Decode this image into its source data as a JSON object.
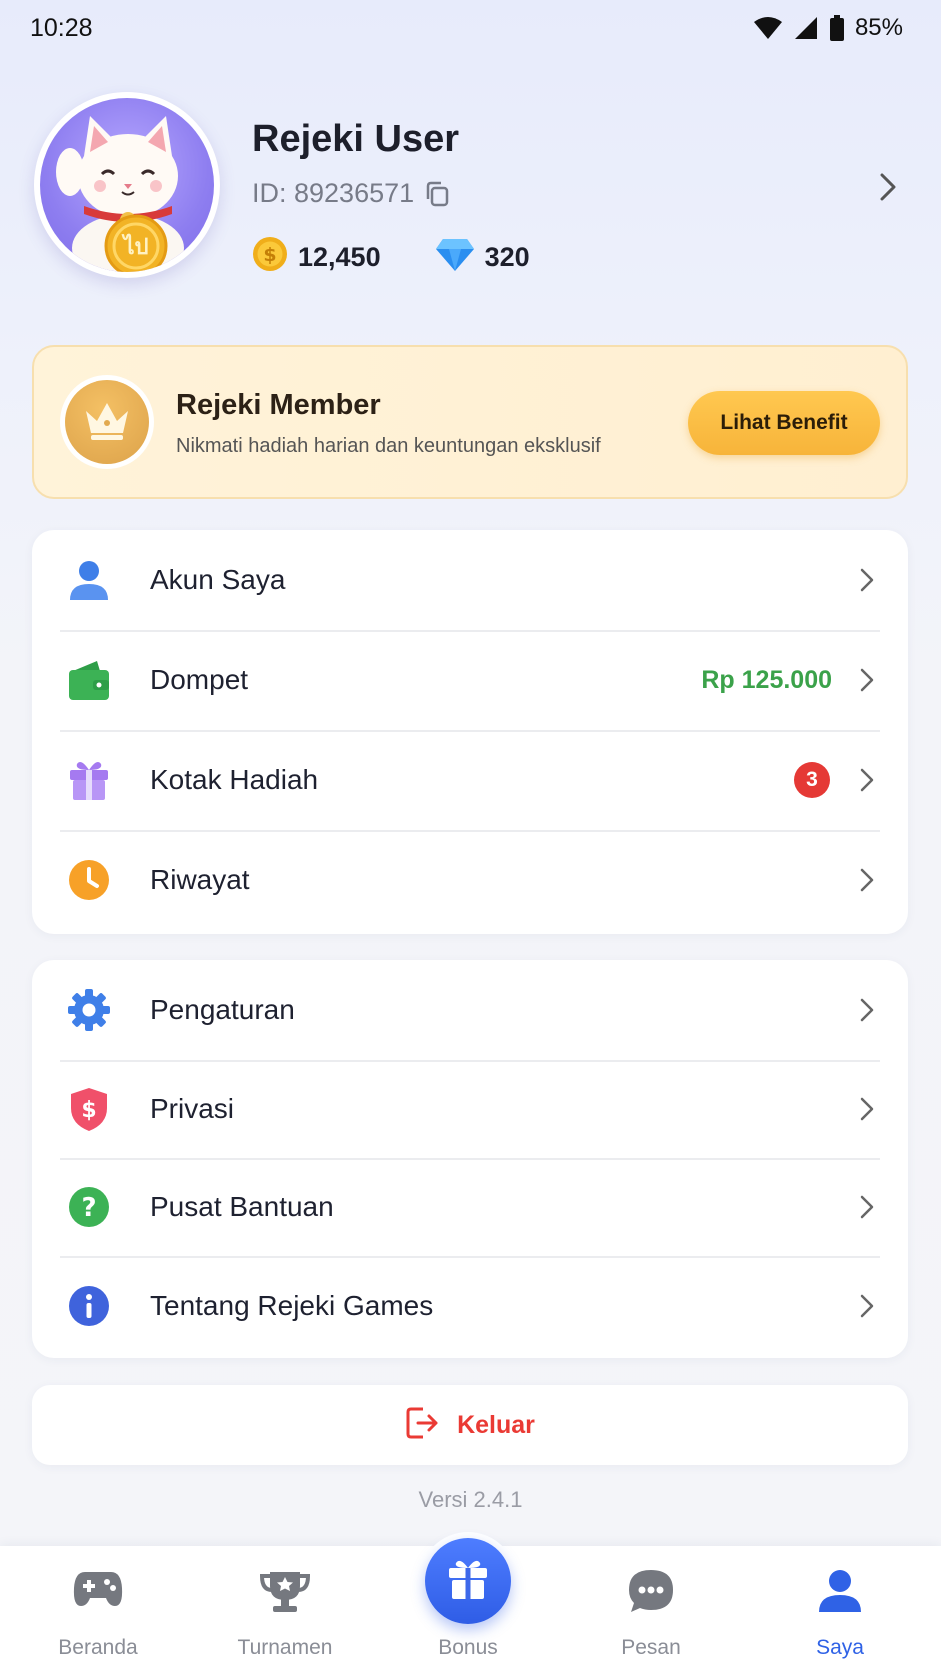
{
  "status_bar": {
    "time": "10:28",
    "battery": "85%"
  },
  "profile": {
    "name": "Rejeki User",
    "id_text": "ID: 89236571",
    "coins": "12,450",
    "diamonds": "320"
  },
  "member": {
    "title": "Rejeki Member",
    "subtitle": "Nikmati hadiah harian dan keuntungan eksklusif",
    "button_label": "Lihat Benefit"
  },
  "menu_group_1": [
    {
      "label": "Akun Saya",
      "icon": "user-icon"
    },
    {
      "label": "Dompet",
      "icon": "wallet-icon",
      "value": "Rp 125.000"
    },
    {
      "label": "Kotak Hadiah",
      "icon": "gift-icon",
      "badge": "3"
    },
    {
      "label": "Riwayat",
      "icon": "clock-icon"
    }
  ],
  "menu_group_2": [
    {
      "label": "Pengaturan",
      "icon": "gear-icon"
    },
    {
      "label": "Privasi",
      "icon": "shield-icon"
    },
    {
      "label": "Pusat Bantuan",
      "icon": "help-icon"
    },
    {
      "label": "Tentang Rejeki Games",
      "icon": "info-icon"
    }
  ],
  "logout_label": "Keluar",
  "version": "Versi 2.4.1",
  "bottom_nav": [
    {
      "label": "Beranda",
      "icon": "gamepad-icon"
    },
    {
      "label": "Turnamen",
      "icon": "trophy-icon"
    },
    {
      "label": "Bonus",
      "icon": "gift-icon"
    },
    {
      "label": "Pesan",
      "icon": "chat-icon"
    },
    {
      "label": "Saya",
      "icon": "user-icon",
      "active": true
    }
  ],
  "colors": {
    "accent": "#2f62e6",
    "wallet_value": "#3ba24a",
    "badge": "#e53935",
    "logout": "#ea3a34",
    "member_button": "#f7b43a"
  }
}
